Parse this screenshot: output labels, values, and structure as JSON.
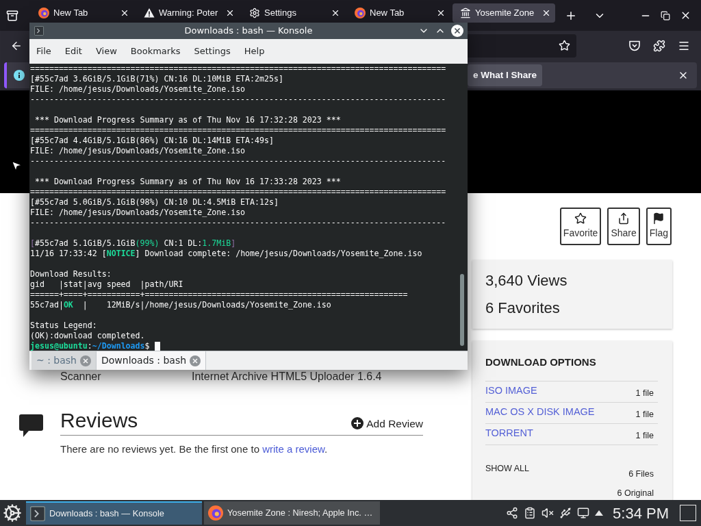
{
  "browser": {
    "tabs": [
      {
        "kind": "newtab",
        "title": "New Tab",
        "selected": false
      },
      {
        "kind": "warning",
        "title": "Warning: Poter",
        "selected": false
      },
      {
        "kind": "settings",
        "title": "Settings",
        "selected": false
      },
      {
        "kind": "newtab",
        "title": "New Tab",
        "selected": false
      },
      {
        "kind": "site",
        "title": "Yosemite Zone",
        "selected": true
      }
    ],
    "notification": {
      "button": "e What I Share"
    },
    "page": {
      "actions": [
        {
          "kind": "favorite",
          "label": "Favorite"
        },
        {
          "kind": "share",
          "label": "Share"
        },
        {
          "kind": "flag",
          "label": "Flag"
        }
      ],
      "stats": [
        "3,640 Views",
        "6 Favorites"
      ],
      "metadata": [
        {
          "label": "Scanner",
          "value": "Internet Archive HTML5 Uploader 1.6.4"
        }
      ],
      "download_options": {
        "title": "DOWNLOAD OPTIONS",
        "items": [
          {
            "label": "ISO IMAGE",
            "count": "1 file"
          },
          {
            "label": "MAC OS X DISK IMAGE",
            "count": "1 file"
          },
          {
            "label": "TORRENT",
            "count": "1 file"
          }
        ],
        "show_all": "SHOW ALL",
        "files": "6 Files",
        "original": "6 Original"
      },
      "reviews": {
        "title": "Reviews",
        "add": "Add Review",
        "text": "There are no reviews yet. Be the first one to",
        "link": "write a review",
        "end": "."
      }
    }
  },
  "konsole": {
    "title": "Downloads : bash — Konsole",
    "menu": [
      "File",
      "Edit",
      "View",
      "Bookmarks",
      "Settings",
      "Help"
    ],
    "blocks": [
      {
        "lines": [
          {
            "text": "======================================================================================="
          },
          {
            "text": "[#55c7ad 3.6GiB/5.1GiB(71%) CN:16 DL:10MiB ETA:2m25s]"
          },
          {
            "text": "FILE: /home/jesus/Downloads/Yosemite_Zone.iso"
          },
          {
            "text": "---------------------------------------------------------------------------------------"
          }
        ]
      },
      {
        "lines": [
          {
            "text": " *** Download Progress Summary as of Thu Nov 16 17:32:28 2023 ***"
          },
          {
            "text": "======================================================================================="
          },
          {
            "text": "[#55c7ad 4.4GiB/5.1GiB(86%) CN:16 DL:14MiB ETA:49s]"
          },
          {
            "text": "FILE: /home/jesus/Downloads/Yosemite_Zone.iso"
          },
          {
            "text": "---------------------------------------------------------------------------------------"
          }
        ]
      },
      {
        "lines": [
          {
            "text": " *** Download Progress Summary as of Thu Nov 16 17:33:28 2023 ***"
          },
          {
            "text": "======================================================================================="
          },
          {
            "text": "[#55c7ad 5.0GiB/5.1GiB(98%) CN:10 DL:4.5MiB ETA:12s]"
          },
          {
            "text": "FILE: /home/jesus/Downloads/Yosemite_Zone.iso"
          },
          {
            "text": "---------------------------------------------------------------------------------------"
          }
        ]
      },
      {
        "lines": [
          {
            "segments": [
              {
                "text": "[",
                "kind": "bracket"
              },
              {
                "text": "#55c7ad 5.1GiB/5.1GiB",
                "kind": "plain"
              },
              {
                "text": "(99%)",
                "kind": "good"
              },
              {
                "text": " CN:1 DL:",
                "kind": "plain"
              },
              {
                "text": "1.7MiB",
                "kind": "good"
              },
              {
                "text": "]",
                "kind": "bracket"
              }
            ]
          },
          {
            "segments": [
              {
                "text": "11/16 17:33:42 [",
                "kind": "plain"
              },
              {
                "text": "NOTICE",
                "kind": "label"
              },
              {
                "text": "] Download complete: /home/jesus/Downloads/Yosemite_Zone.iso",
                "kind": "plain"
              }
            ]
          }
        ]
      },
      {
        "lines": [
          {
            "text": "Download Results:"
          },
          {
            "text": "gid   |stat|avg speed  |path/URI"
          },
          {
            "text": "======+====+===========+======================================================="
          },
          {
            "segments": [
              {
                "text": "55c7ad|",
                "kind": "plain"
              },
              {
                "text": "OK",
                "kind": "label"
              },
              {
                "text": "  |    12MiB/s|/home/jesus/Downloads/Yosemite_Zone.iso",
                "kind": "plain"
              }
            ]
          }
        ]
      },
      {
        "lines": [
          {
            "text": "Status Legend:"
          },
          {
            "text": "(OK):download completed."
          },
          {
            "segments": [
              {
                "text": "jesus@ubuntu",
                "kind": "user"
              },
              {
                "text": ":",
                "kind": "plain"
              },
              {
                "text": "~/Downloads",
                "kind": "dir"
              },
              {
                "text": "$",
                "kind": "plain"
              }
            ],
            "cursor": true
          }
        ]
      }
    ],
    "tabs": [
      {
        "label": "~ : bash",
        "selected": false
      },
      {
        "label": "Downloads : bash",
        "selected": true
      }
    ]
  },
  "taskbar": {
    "tasks": [
      {
        "kind": "terminal",
        "label": "Downloads : bash — Konsole",
        "selected": true
      },
      {
        "kind": "browser",
        "label": "Yosemite Zone : Niresh; Apple Inc. …",
        "selected": false
      }
    ],
    "clock": "5:34 PM"
  }
}
